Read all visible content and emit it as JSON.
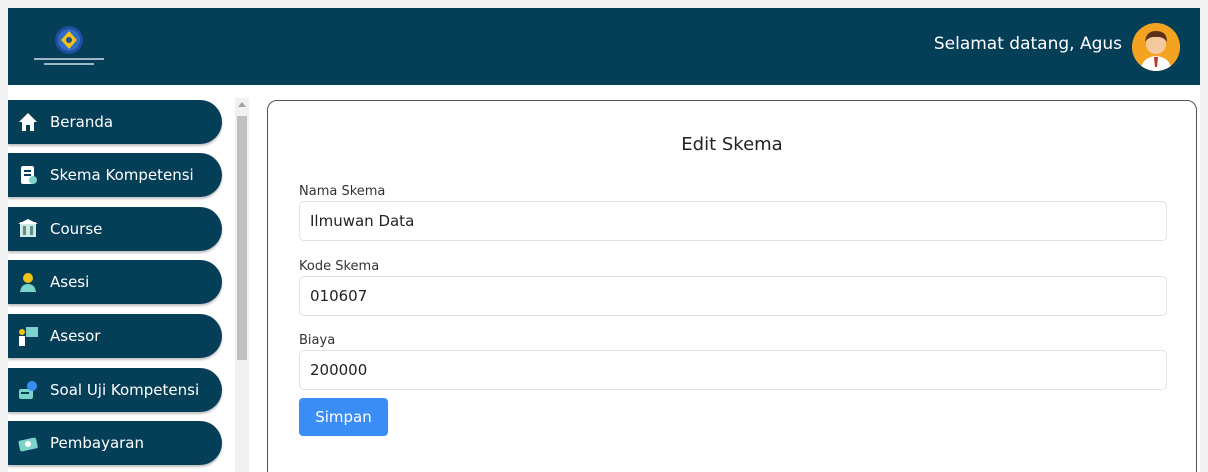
{
  "header": {
    "welcome": "Selamat datang, Agus",
    "brand_color": "#053e57"
  },
  "sidebar": {
    "items": [
      {
        "label": "Beranda",
        "icon": "home-icon"
      },
      {
        "label": "Skema Kompetensi",
        "icon": "document-icon"
      },
      {
        "label": "Course",
        "icon": "course-icon"
      },
      {
        "label": "Asesi",
        "icon": "user-icon"
      },
      {
        "label": "Asesor",
        "icon": "presenter-icon"
      },
      {
        "label": "Soal Uji Kompetensi",
        "icon": "exam-icon"
      },
      {
        "label": "Pembayaran",
        "icon": "payment-icon"
      }
    ]
  },
  "form": {
    "title": "Edit Skema",
    "fields": [
      {
        "label": "Nama Skema",
        "value": "Ilmuwan Data"
      },
      {
        "label": "Kode Skema",
        "value": "010607"
      },
      {
        "label": "Biaya",
        "value": "200000"
      }
    ],
    "submit_label": "Simpan",
    "button_color": "#3b8df6"
  }
}
